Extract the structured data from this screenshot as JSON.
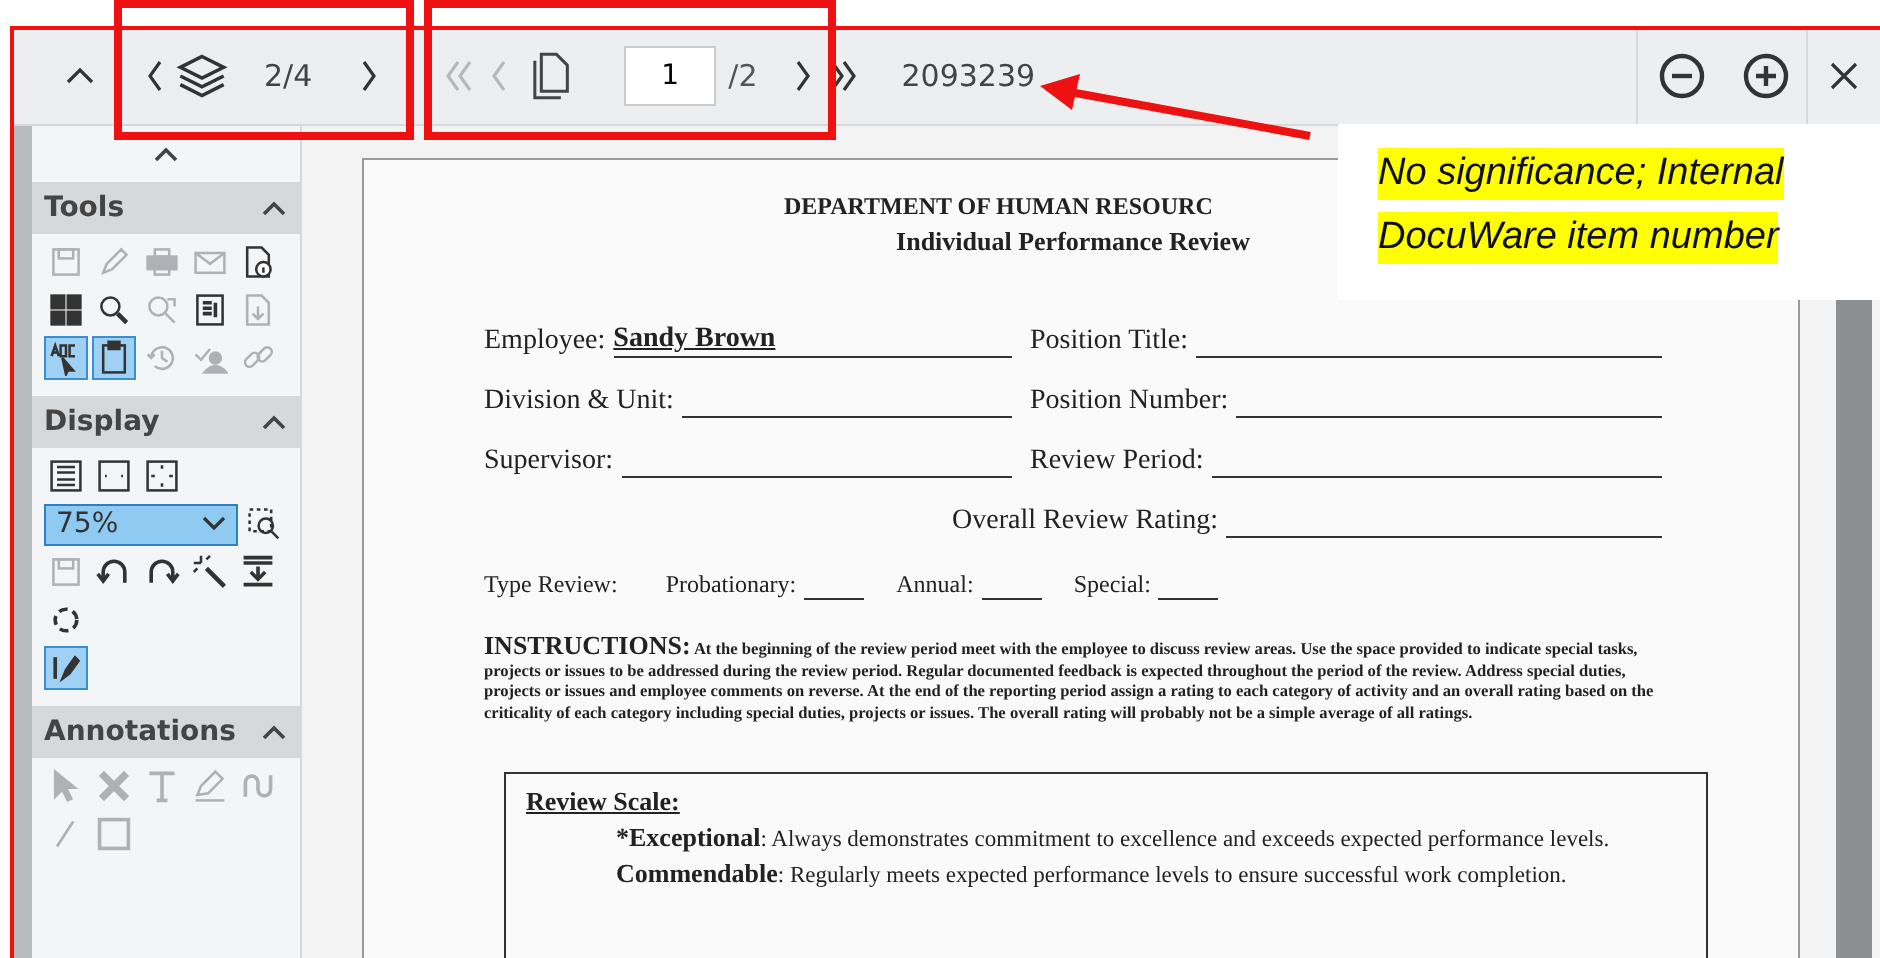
{
  "toolbar": {
    "layers": {
      "counter": "2/4"
    },
    "nav": [
      {
        "kind": "first",
        "disabled": true
      },
      {
        "kind": "prev",
        "disabled": true
      },
      {
        "kind": "next",
        "disabled": false
      },
      {
        "kind": "last",
        "disabled": false
      }
    ],
    "page_input": "1",
    "page_total": "/2",
    "item_number": "2093239"
  },
  "sidebar": {
    "sections": [
      {
        "title": "Tools",
        "expanded": true,
        "rows": [
          [
            {
              "kind": "save",
              "disabled": true,
              "selected": false
            },
            {
              "kind": "pencil",
              "disabled": true,
              "selected": false
            },
            {
              "kind": "printer",
              "disabled": true,
              "selected": false
            },
            {
              "kind": "mail",
              "disabled": true,
              "selected": false
            },
            {
              "kind": "doc-info",
              "disabled": false,
              "selected": false
            }
          ],
          [
            {
              "kind": "grid",
              "disabled": false,
              "selected": false
            },
            {
              "kind": "search",
              "disabled": false,
              "selected": false
            },
            {
              "kind": "search-refresh",
              "disabled": true,
              "selected": false
            },
            {
              "kind": "doc-list",
              "disabled": false,
              "selected": false
            },
            {
              "kind": "doc-download",
              "disabled": true,
              "selected": false
            }
          ],
          [
            {
              "kind": "abc-cursor",
              "disabled": false,
              "selected": true
            },
            {
              "kind": "clipboard",
              "disabled": false,
              "selected": true
            },
            {
              "kind": "history",
              "disabled": true,
              "selected": false
            },
            {
              "kind": "check-user",
              "disabled": true,
              "selected": false
            },
            {
              "kind": "link",
              "disabled": true,
              "selected": false
            }
          ]
        ]
      },
      {
        "title": "Display",
        "expanded": true,
        "rows": [
          [
            {
              "kind": "fit-height",
              "disabled": false,
              "selected": false
            },
            {
              "kind": "fit-width",
              "disabled": false,
              "selected": false
            },
            {
              "kind": "fit-page",
              "disabled": false,
              "selected": false
            }
          ],
          [
            {
              "kind": "dropdown",
              "value": "75%"
            },
            {
              "kind": "zoom-area",
              "disabled": false,
              "selected": false
            }
          ],
          [
            {
              "kind": "save",
              "disabled": true,
              "selected": false
            },
            {
              "kind": "rotate-left",
              "disabled": false,
              "selected": false
            },
            {
              "kind": "rotate-right",
              "disabled": false,
              "selected": false
            },
            {
              "kind": "wand",
              "disabled": false,
              "selected": false
            },
            {
              "kind": "download-bar",
              "disabled": false,
              "selected": false
            }
          ],
          [
            {
              "kind": "cycle",
              "disabled": false,
              "selected": false
            }
          ],
          [
            {
              "kind": "pen",
              "disabled": false,
              "selected": true
            }
          ]
        ]
      },
      {
        "title": "Annotations",
        "expanded": true,
        "rows": [
          [
            {
              "kind": "arrow-cursor",
              "disabled": true,
              "selected": false
            },
            {
              "kind": "cross",
              "disabled": true,
              "selected": false
            },
            {
              "kind": "text",
              "disabled": true,
              "selected": false
            },
            {
              "kind": "highlighter",
              "disabled": true,
              "selected": false
            },
            {
              "kind": "curve",
              "disabled": true,
              "selected": false
            }
          ],
          [
            {
              "kind": "line",
              "disabled": true,
              "selected": false
            },
            {
              "kind": "rectangle",
              "disabled": true,
              "selected": false
            }
          ]
        ]
      }
    ]
  },
  "document": {
    "title": "DEPARTMENT OF HUMAN RESOURC",
    "subtitle": "Individual Performance Review",
    "field_rows": [
      [
        {
          "label": "Employee:",
          "value": "Sandy Brown"
        },
        {
          "label": "Position Title:"
        }
      ],
      [
        {
          "label": "Division & Unit:"
        },
        {
          "label": "Position Number:"
        }
      ],
      [
        {
          "label": "Supervisor:"
        },
        {
          "label": "Review Period:"
        }
      ]
    ],
    "overall_rating": {
      "label": "Overall Review Rating:"
    },
    "type_review": {
      "label": "Type Review:",
      "options": [
        "Probationary:",
        "Annual:",
        "Special:"
      ]
    },
    "instructions": {
      "heading": "INSTRUCTIONS:",
      "text": "At the beginning of the review period meet with the employee to discuss review areas.  Use the space provided to indicate special tasks, projects or issues to be addressed during the review period.  Regular documented feedback is expected throughout the period of the review.  Address special duties, projects or  issues and employee comments on reverse.  At the end of the reporting period assign a rating to each category of activity and an overall rating based on the criticality of  each category including special duties, projects or  issues.  The overall rating will probably not be a simple average of all ratings."
    },
    "review_scale": {
      "title": "Review Scale:",
      "levels": [
        {
          "term": "*Exceptional",
          "text": ":  Always demonstrates commitment to excellence and exceeds expected performance levels."
        },
        {
          "term": "Commendable",
          "text": ":  Regularly meets expected performance levels to ensure successful work completion."
        }
      ]
    }
  },
  "callout": {
    "lines": [
      "No significance; Internal",
      "DocuWare item number"
    ]
  }
}
